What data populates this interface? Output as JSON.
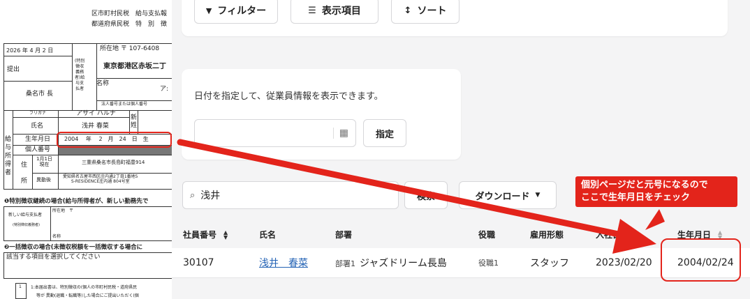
{
  "paper": {
    "header_line1": "区市町村民税　給与支払報",
    "header_line2": "都道府県民税　特　別　徴",
    "date": "2026 年 4 月 2 日",
    "submitted": "提出",
    "municipality": "桑名市 長",
    "special_payer": "(特別\n徴収\n義務\n者)給\n与支\n払者",
    "address_label": "所在地 〒 107-6408",
    "address_value": "東京都港区赤坂二丁",
    "name_label": "名称",
    "name_value": "ア:",
    "corp_number": "法人番号または個人番号",
    "furigana_label": "フリガナ",
    "furigana_value": "アサイ ハルナ",
    "shimei_label": "氏名",
    "shimei_value": "浅井 春菜",
    "new_label": "新\n姓",
    "birth_label": "生年月日",
    "birth_value": "2004　 年　 2　月　24　日　生",
    "kojin_label": "個人番号",
    "side_label": "給\n与\n所\n得\n者",
    "addr_label": "住",
    "addr_sub": "所",
    "jan1_label": "1月1日\n現在",
    "jan1_value": "三重県桑名市長島町福豊914",
    "move_label": "異動後",
    "move_value": "愛知県名古屋市西区庄内通2丁目1番地5\nS-RESIDENCE庄内通 804号室",
    "section1": "❶特別徴収継続の場合(給与所得者が、新しい勤務先で",
    "new_payer": "新しい給与支払者",
    "new_payer_sub": "(特別徴収義務者)",
    "shozaichi": "所在地　〒",
    "meisho": "名称",
    "section2": "❷一括徴収の場合(未徴収税額を一括徴収する場合に",
    "select_text": "該当する項目を選択してください",
    "footnote_num": "1",
    "footnote1": "1:本届出書は、特別徴収の(個人の市町村民税・道府県民",
    "footnote2": "等が 異動(退職・転職等)した場合にご提出いただく(個"
  },
  "toolbar": {
    "filter": "フィルター",
    "columns": "表示項目",
    "sort": "ソート"
  },
  "date_card": {
    "message": "日付を指定して、従業員情報を表示できます。",
    "date_placeholder": "",
    "apply": "指定"
  },
  "search": {
    "value": "浅井",
    "search_button": "検索",
    "download": "ダウンロード"
  },
  "table": {
    "headers": [
      "社員番号",
      "氏名",
      "部署",
      "役職",
      "雇用形態",
      "入社日",
      "生年月日"
    ],
    "row": {
      "id": "30107",
      "name": "浅井　春菜",
      "dept_tag": "部署1",
      "dept": "ジャズドリーム長島",
      "role_tag": "役職1",
      "employment": "スタッフ",
      "hire_date": "2023/02/20",
      "birthdate": "2004/02/24"
    }
  },
  "annotation": {
    "line1": "個別ページだと元号になるので",
    "line2": "ここで生年月日をチェック",
    "color": "#e3241b"
  }
}
